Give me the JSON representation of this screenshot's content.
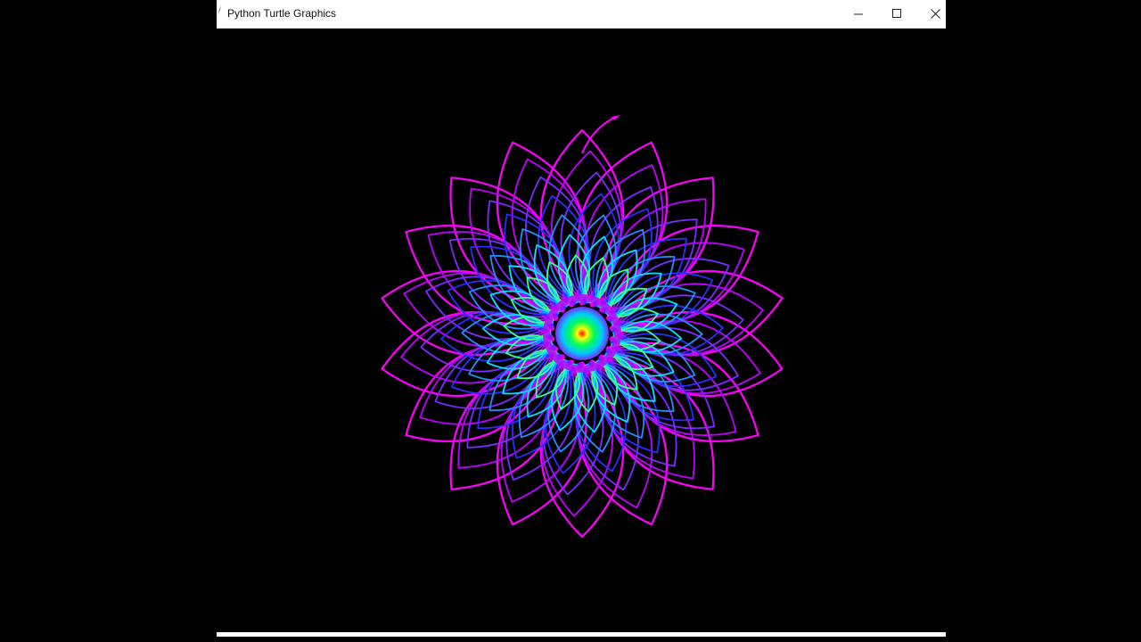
{
  "window": {
    "title": "Python Turtle Graphics",
    "controls": {
      "minimize_icon": "minimize-icon",
      "maximize_icon": "maximize-icon",
      "close_icon": "close-icon"
    }
  },
  "canvas": {
    "background": "#000000",
    "drawing": {
      "type": "spirograph-flower",
      "petal_count": 18,
      "layer_colors": [
        "#ff00ff",
        "#c000ff",
        "#7a2bff",
        "#2c2cff",
        "#1e90ff",
        "#00e5ff",
        "#3dff8a"
      ],
      "center_gradient": [
        "#ff0000",
        "#ffff00",
        "#00ff55",
        "#00c8ff",
        "#7a2bff"
      ],
      "turtle_cursor": "arrow-icon"
    }
  }
}
